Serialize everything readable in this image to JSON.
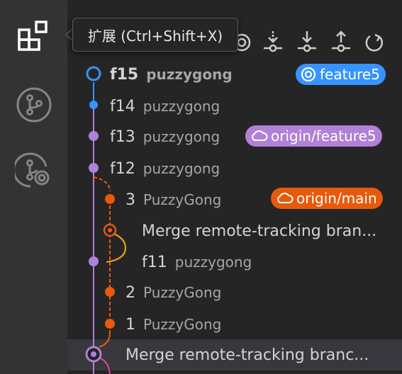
{
  "tooltip": {
    "text": "扩展 (Ctrl+Shift+X)"
  },
  "activity_bar": {
    "items": [
      {
        "name": "extensions-icon"
      },
      {
        "name": "source-control-icon"
      },
      {
        "name": "remote-source-control-icon"
      }
    ]
  },
  "toolbar": {
    "icons": [
      "target-icon",
      "fetch-icon",
      "pull-icon",
      "push-icon",
      "refresh-icon"
    ]
  },
  "commits": [
    {
      "message": "f15",
      "author": "puzzygong",
      "bold": true
    },
    {
      "message": "f14",
      "author": "puzzygong"
    },
    {
      "message": "f13",
      "author": "puzzygong"
    },
    {
      "message": "f12",
      "author": "puzzygong"
    },
    {
      "message": "3",
      "author": "PuzzyGong"
    },
    {
      "message": "Merge remote-tracking bran...",
      "author": ""
    },
    {
      "message": "f11",
      "author": "puzzygong"
    },
    {
      "message": "2",
      "author": "PuzzyGong"
    },
    {
      "message": "1",
      "author": "PuzzyGong"
    },
    {
      "message": "Merge remote-tracking branc...",
      "author": ""
    }
  ],
  "badges": {
    "feature5": {
      "label": "feature5",
      "color": "#3794ff",
      "icon": "target-icon"
    },
    "origin_feature5": {
      "label": "origin/feature5",
      "color": "#b180d7",
      "icon": "cloud-icon"
    },
    "origin_main": {
      "label": "origin/main",
      "color": "#e8590c",
      "icon": "cloud-icon"
    }
  },
  "colors": {
    "blue": "#3794ff",
    "purple": "#b180d7",
    "orange": "#e8590c",
    "yellow": "#f5a623",
    "pink": "#e0459b"
  }
}
